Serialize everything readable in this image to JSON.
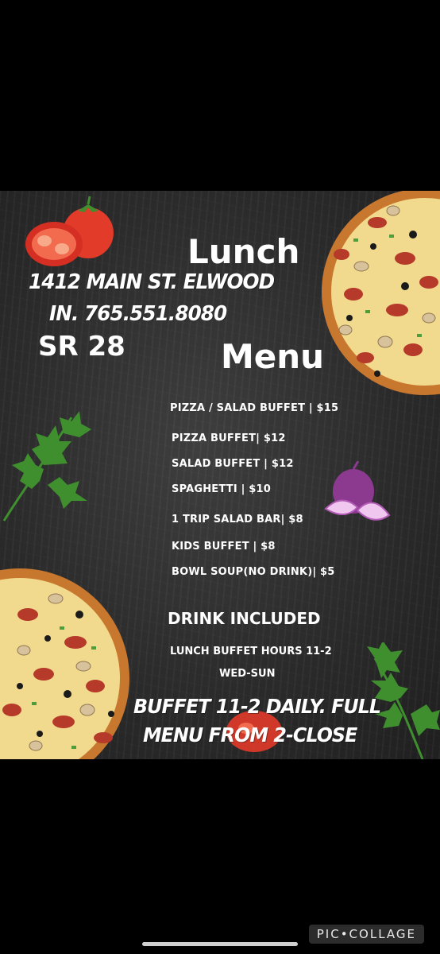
{
  "header": {
    "title_line1": "Lunch",
    "title_line2": "Menu"
  },
  "address": {
    "line1": "1412 MAIN ST. ELWOOD",
    "line2": "IN. 765.551.8080",
    "route": "SR 28"
  },
  "menu_items": [
    "PIZZA / SALAD BUFFET | $15",
    "PIZZA BUFFET| $12",
    "SALAD BUFFET | $12",
    "SPAGHETTI | $10",
    "1 TRIP SALAD BAR| $8",
    "KIDS BUFFET | $8",
    "BOWL SOUP(NO DRINK)| $5"
  ],
  "drink_note": "DRINK INCLUDED",
  "hours": {
    "line1": "LUNCH BUFFET HOURS 11-2",
    "line2": "WED-SUN"
  },
  "footer_note": {
    "line1": "BUFFET 11-2 DAILY. FULL",
    "line2": "MENU FROM 2-CLOSE"
  },
  "watermark": "PIC•COLLAGE",
  "icons": [
    "pizza-icon",
    "tomato-icon",
    "parsley-icon",
    "onion-icon"
  ],
  "colors": {
    "background": "#000000",
    "chalkboard": "#2e2e2e",
    "text": "#ffffff",
    "tomato": "#e23b2a",
    "parsley": "#3f8f2f",
    "onion": "#b25ab5"
  }
}
